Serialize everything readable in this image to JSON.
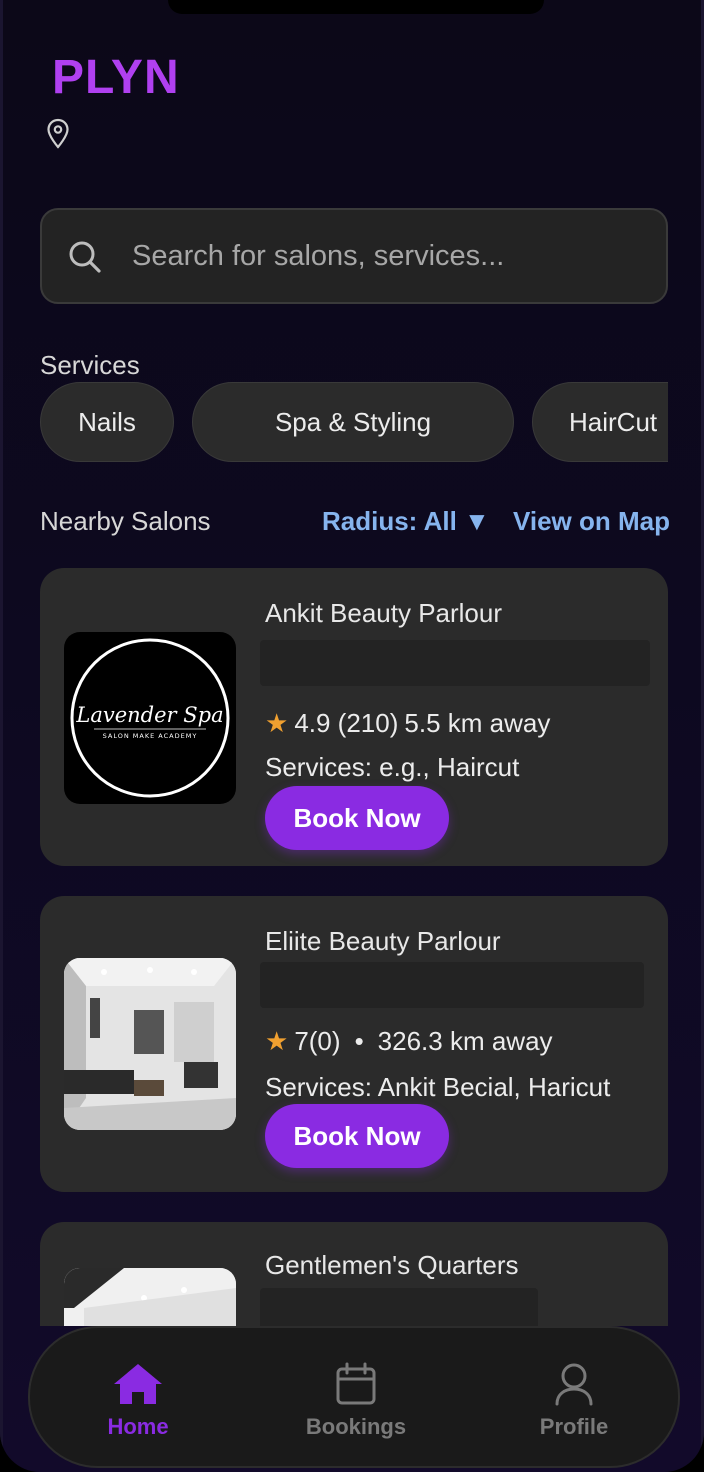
{
  "app": {
    "brand": "PLYN"
  },
  "search": {
    "placeholder": "Search for salons, services..."
  },
  "services": {
    "title": "Services",
    "chips": [
      "Nails",
      "Spa & Styling",
      "HairCut"
    ]
  },
  "nearby": {
    "title": "Nearby Salons",
    "radius_label": "Radius: All ▼",
    "view_map_label": "View on Map"
  },
  "salons": [
    {
      "name": "Ankit Beauty Parlour",
      "rating": "4.9 (210)",
      "distance": "5.5 km away",
      "services": "Services: e.g., Haircut",
      "book_label": "Book Now",
      "logo_text": "Lavender Spa",
      "logo_subtext": "SALON MAKE ACADEMY"
    },
    {
      "name": "Eliite Beauty Parlour",
      "rating": "7(0)",
      "separator": "•",
      "distance": "326.3 km away",
      "services": "Services: Ankit Becial, Haricut",
      "book_label": "Book Now"
    },
    {
      "name": "Gentlemen's Quarters"
    }
  ],
  "tabbar": {
    "tabs": [
      {
        "label": "Home",
        "icon": "home-icon",
        "active": true
      },
      {
        "label": "Bookings",
        "icon": "calendar-icon",
        "active": false
      },
      {
        "label": "Profile",
        "icon": "user-icon",
        "active": false
      }
    ]
  },
  "colors": {
    "accent": "#8a2be2",
    "brand": "#b040f0",
    "link": "#86b4ee",
    "star": "#f0a030"
  }
}
